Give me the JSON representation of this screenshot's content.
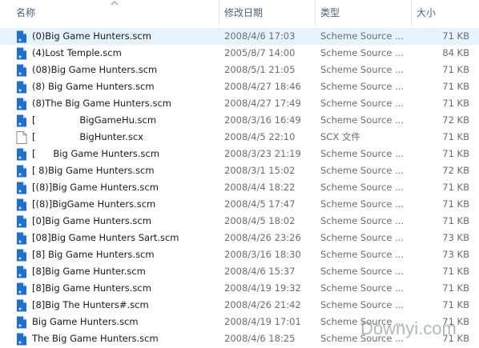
{
  "header": {
    "name_label": "名称",
    "date_label": "修改日期",
    "type_label": "类型",
    "size_label": "大小"
  },
  "files": [
    {
      "name": "(0)Big Game Hunters.scm",
      "date": "2008/4/6 17:03",
      "type": "Scheme Source ...",
      "size": "71 KB",
      "icon": "scheme-file-icon",
      "selected": true
    },
    {
      "name": "(4)Lost Temple.scm",
      "date": "2005/8/7 14:00",
      "type": "Scheme Source ...",
      "size": "84 KB",
      "icon": "scheme-file-icon"
    },
    {
      "name": "(08)Big Game Hunters.scm",
      "date": "2008/5/1 21:05",
      "type": "Scheme Source ...",
      "size": "71 KB",
      "icon": "scheme-file-icon"
    },
    {
      "name": "(8) Big Game Hunters.scm",
      "date": "2008/4/27 18:46",
      "type": "Scheme Source ...",
      "size": "71 KB",
      "icon": "scheme-file-icon"
    },
    {
      "name": "(8)The Big Game Hunters.scm",
      "date": "2008/4/27 17:49",
      "type": "Scheme Source ...",
      "size": "71 KB",
      "icon": "scheme-file-icon"
    },
    {
      "name": "[               BigGameHu.scm",
      "date": "2008/3/16 16:49",
      "type": "Scheme Source ...",
      "size": "72 KB",
      "icon": "scheme-file-icon"
    },
    {
      "name": "[               BigHunter.scx",
      "date": "2008/4/5 22:10",
      "type": "SCX 文件",
      "size": "71 KB",
      "icon": "blank-file-icon"
    },
    {
      "name": "[      Big Game Hunters.scm",
      "date": "2008/3/23 21:19",
      "type": "Scheme Source ...",
      "size": "71 KB",
      "icon": "scheme-file-icon"
    },
    {
      "name": "[ 8)Big Game Hunters.scm",
      "date": "2008/3/1 15:02",
      "type": "Scheme Source ...",
      "size": "72 KB",
      "icon": "scheme-file-icon"
    },
    {
      "name": "[(8)]Big Game Hunters.scm",
      "date": "2008/4/4 18:22",
      "type": "Scheme Source ...",
      "size": "71 KB",
      "icon": "scheme-file-icon"
    },
    {
      "name": "[(8)]BigGame Hunters.scm",
      "date": "2008/4/5 17:47",
      "type": "Scheme Source ...",
      "size": "71 KB",
      "icon": "scheme-file-icon"
    },
    {
      "name": "[0]Big Game Hunters.scm",
      "date": "2008/4/5 18:02",
      "type": "Scheme Source ...",
      "size": "71 KB",
      "icon": "scheme-file-icon"
    },
    {
      "name": "[08]Big Game Hunters Sart.scm",
      "date": "2008/4/26 23:26",
      "type": "Scheme Source ...",
      "size": "73 KB",
      "icon": "scheme-file-icon"
    },
    {
      "name": "[8] Big Game Hunters.scm",
      "date": "2008/3/16 18:30",
      "type": "Scheme Source ...",
      "size": "73 KB",
      "icon": "scheme-file-icon"
    },
    {
      "name": "[8]Big Game Hunter.scm",
      "date": "2008/4/6 15:37",
      "type": "Scheme Source ...",
      "size": "71 KB",
      "icon": "scheme-file-icon"
    },
    {
      "name": "[8]Big Game Hunters.scm",
      "date": "2008/4/19 19:32",
      "type": "Scheme Source ...",
      "size": "71 KB",
      "icon": "scheme-file-icon"
    },
    {
      "name": "[8]Big The Hunters#.scm",
      "date": "2008/4/26 21:42",
      "type": "Scheme Source ...",
      "size": "71 KB",
      "icon": "scheme-file-icon"
    },
    {
      "name": "Big Game Hunters.scm",
      "date": "2008/4/19 17:01",
      "type": "Scheme Source ...",
      "size": "71 KB",
      "icon": "scheme-file-icon"
    },
    {
      "name": "The Big Game Hunters.scm",
      "date": "2008/4/6 18:25",
      "type": "Scheme Source ...",
      "size": "71 KB",
      "icon": "scheme-file-icon"
    }
  ],
  "watermark": "Downyi.com",
  "colors": {
    "selected_row": "#e5f3ff",
    "header_text": "#4c607a",
    "scheme_icon": "#1f6fd1"
  }
}
